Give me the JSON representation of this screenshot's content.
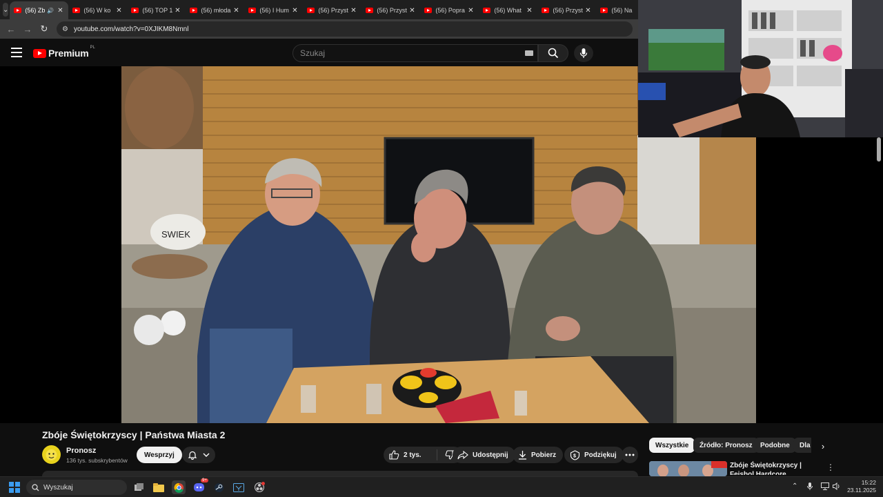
{
  "browser": {
    "tabs": [
      {
        "label": "(56) Zb",
        "active": true,
        "audio": true
      },
      {
        "label": "(56) W ko"
      },
      {
        "label": "(56) TOP 1"
      },
      {
        "label": "(56) młoda"
      },
      {
        "label": "(56) I Hum"
      },
      {
        "label": "(56) Przyst"
      },
      {
        "label": "(56) Przyst"
      },
      {
        "label": "(56) Popra"
      },
      {
        "label": "(56) What"
      },
      {
        "label": "(56) Przyst"
      },
      {
        "label": "(56) Na"
      }
    ],
    "url": "youtube.com/watch?v=0XJIKM8Nmnl"
  },
  "youtube": {
    "logo_text": "Premium",
    "region": "PL",
    "search_placeholder": "Szukaj"
  },
  "video": {
    "title": "Zbóje Świętokrzyscy | Państwa Miasta 2",
    "helmet_text": "SWIEK"
  },
  "channel": {
    "name": "Pronosz",
    "subscribers": "136 tys. subskrybentów",
    "support_label": "Wesprzyj"
  },
  "actions": {
    "likes": "2 tys.",
    "share": "Udostępnij",
    "download": "Pobierz",
    "thanks": "Podziękuj"
  },
  "chips": [
    "Wszystkie",
    "Źródło: Pronosz",
    "Podobne",
    "Dla"
  ],
  "recommendation": {
    "title": "Zbóje Świętokrzyscy | Fejsbol Hardcore"
  },
  "taskbar": {
    "search_label": "Wyszukaj",
    "time": "15:22",
    "date": "23.11.2025",
    "discord_badge": "9+"
  },
  "colors": {
    "accent_red": "#ff0000",
    "background": "#0f0f0f",
    "chip_selected": "#f1f1f1"
  }
}
